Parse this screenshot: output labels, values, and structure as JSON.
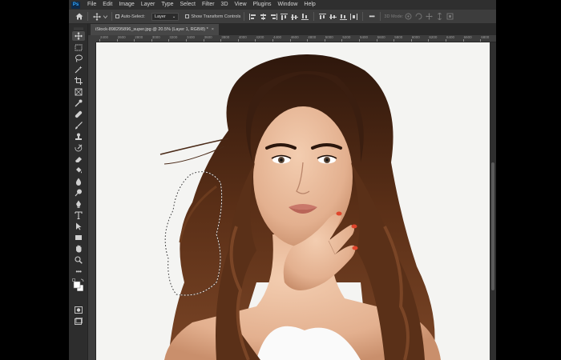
{
  "menubar": {
    "logo": "Ps",
    "items": [
      "File",
      "Edit",
      "Image",
      "Layer",
      "Type",
      "Select",
      "Filter",
      "3D",
      "View",
      "Plugins",
      "Window",
      "Help"
    ]
  },
  "options": {
    "auto_select_label": "Auto-Select:",
    "target_value": "Layer",
    "transform_label": "Show Transform Controls",
    "mode_3d_label": "3D Mode:"
  },
  "document": {
    "tab_title": "iStock-898295896_super.jpg @ 20.5% (Layer 1, RGB/8) *",
    "close_glyph": "×"
  },
  "ruler": {
    "top_ticks": [
      "2400",
      "2600",
      "2800",
      "3000",
      "3200",
      "3400",
      "3600",
      "3800",
      "4000",
      "4200",
      "4400",
      "4600",
      "4800",
      "5000",
      "5200",
      "5400",
      "5600",
      "5800",
      "6000",
      "6200",
      "6400",
      "6600",
      "6800"
    ]
  },
  "colors": {
    "chrome": "#3c3c3c",
    "menubar": "#2f2f2f",
    "toolbar": "#2d2d2d",
    "canvas_bg": "#f4f4f2",
    "hair": "#4a2a18",
    "nails": "#e0452c"
  },
  "icons": {
    "home": "home-icon",
    "move": "move-icon",
    "more": "more-icon"
  }
}
